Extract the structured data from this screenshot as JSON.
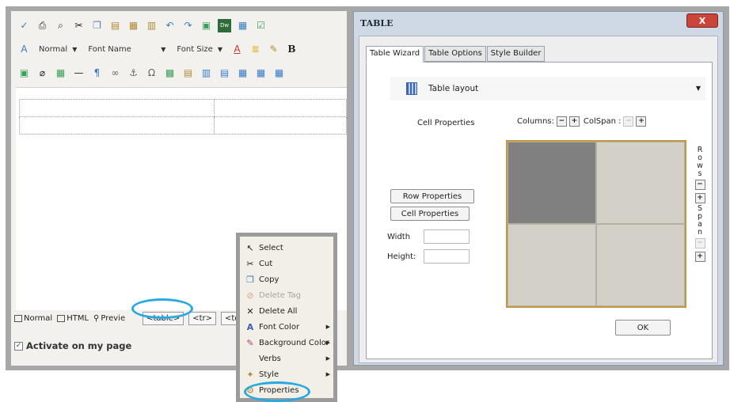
{
  "editor": {
    "toolbar2": {
      "format_value": "Normal",
      "font_name_value": "Font Name",
      "font_size_value": "Font Size",
      "bold_label": "B",
      "font_color_glyph": "A"
    },
    "viewbar": {
      "normal_label": "Normal",
      "html_label": "HTML",
      "preview_label": "Previe",
      "tags": [
        "<table>",
        "<tr>",
        "<td>"
      ]
    },
    "activate_label": "Activate on my page"
  },
  "dialog": {
    "title": "TABLE",
    "close_glyph": "X",
    "tabs": [
      "Table Wizard",
      "Table Options",
      "Style Builder"
    ],
    "layout_label": "Table layout",
    "cell_properties_label": "Cell Properties",
    "columns_label": "Columns:",
    "colspan_label": "ColSpan :",
    "row_properties_button": "Row Properties",
    "cell_properties_button": "Cell Properties",
    "width_label": "Width",
    "height_label": "Height:",
    "rows_letters": [
      "R",
      "o",
      "w",
      "s"
    ],
    "span_letters": [
      "S",
      "p",
      "a",
      "n"
    ],
    "ok_button": "OK"
  },
  "context_menu": {
    "items": [
      {
        "label": "Select",
        "icon": "cursor-plus-icon"
      },
      {
        "label": "Cut",
        "icon": "scissors-icon"
      },
      {
        "label": "Copy",
        "icon": "copy-icon"
      },
      {
        "label": "Delete Tag",
        "icon": "delete-tag-icon",
        "disabled": true
      },
      {
        "label": "Delete All",
        "icon": "x-icon"
      },
      {
        "label": "Font Color",
        "icon": "font-color-icon",
        "submenu": true
      },
      {
        "label": "Background Color",
        "icon": "paint-brush-icon",
        "submenu": true
      },
      {
        "label": "Verbs",
        "icon": "",
        "submenu": true
      },
      {
        "label": "Style",
        "icon": "style-icon",
        "submenu": true
      },
      {
        "label": "Properties",
        "icon": "properties-icon"
      }
    ]
  },
  "colors": {
    "highlight": "#29a9e1",
    "selected_cell": "#808080",
    "cell": "#d3d0c8",
    "grid_border": "#c29940"
  }
}
